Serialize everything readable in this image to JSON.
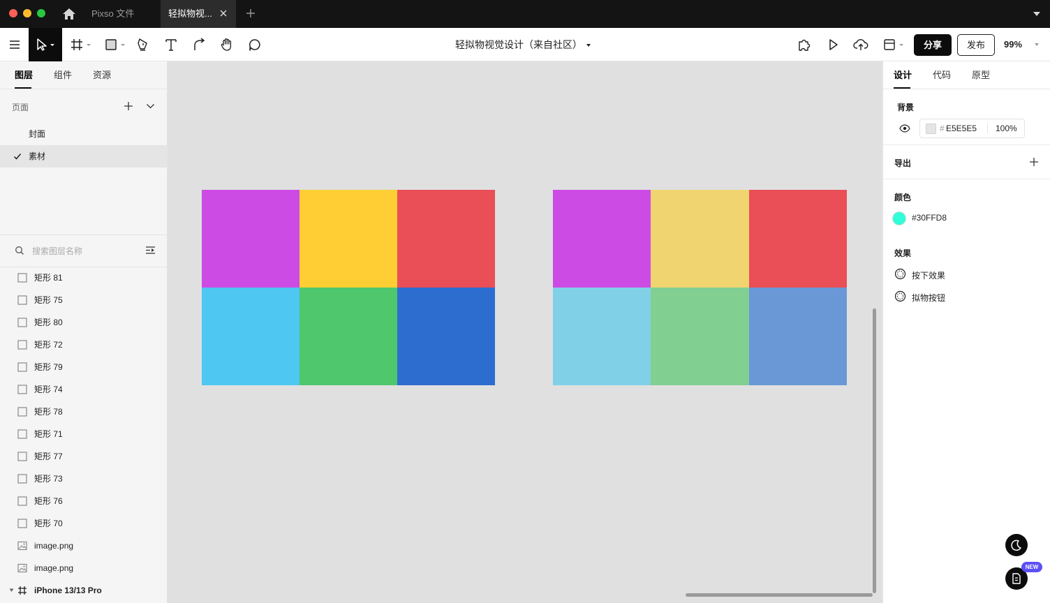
{
  "titlebar": {
    "tabs": [
      {
        "label": "Pixso 文件"
      },
      {
        "label": "轻拟物视..."
      }
    ]
  },
  "toolbar": {
    "doc_title": "轻拟物视觉设计（来自社区）",
    "share_label": "分享",
    "publish_label": "发布",
    "zoom": "99%"
  },
  "left_panel": {
    "tabs": [
      {
        "label": "图层"
      },
      {
        "label": "组件"
      },
      {
        "label": "资源"
      }
    ],
    "pages_label": "页面",
    "pages": [
      {
        "label": "封面"
      },
      {
        "label": "素材"
      }
    ],
    "search_placeholder": "搜索图层名称",
    "layers": [
      {
        "label": "矩形 81"
      },
      {
        "label": "矩形 75"
      },
      {
        "label": "矩形 80"
      },
      {
        "label": "矩形 72"
      },
      {
        "label": "矩形 79"
      },
      {
        "label": "矩形 74"
      },
      {
        "label": "矩形 78"
      },
      {
        "label": "矩形 71"
      },
      {
        "label": "矩形 77"
      },
      {
        "label": "矩形 73"
      },
      {
        "label": "矩形 76"
      },
      {
        "label": "矩形 70"
      },
      {
        "label": "image.png"
      },
      {
        "label": "image.png"
      },
      {
        "label": "iPhone 13/13 Pro"
      }
    ]
  },
  "canvas": {
    "background": "#E0E0E0",
    "grid_left": [
      "#CD4BE5",
      "#FFCE34",
      "#EA4E57",
      "#4EC7F2",
      "#4FC76C",
      "#2D6DD0"
    ],
    "grid_right": [
      "#CD4BE5",
      "#F0D46F",
      "#EA4E57",
      "#80D0E8",
      "#82CF92",
      "#6A98D6"
    ]
  },
  "right_panel": {
    "tabs": [
      {
        "label": "设计"
      },
      {
        "label": "代码"
      },
      {
        "label": "原型"
      }
    ],
    "background_title": "背景",
    "background_hash": "#",
    "background_hex": "E5E5E5",
    "background_opacity": "100%",
    "export_title": "导出",
    "color_title": "颜色",
    "color_value": "#30FFD8",
    "color_swatch": "#30FFD8",
    "effects_title": "效果",
    "effects": [
      {
        "label": "按下效果"
      },
      {
        "label": "拟物按钮"
      }
    ],
    "new_badge": "NEW"
  }
}
